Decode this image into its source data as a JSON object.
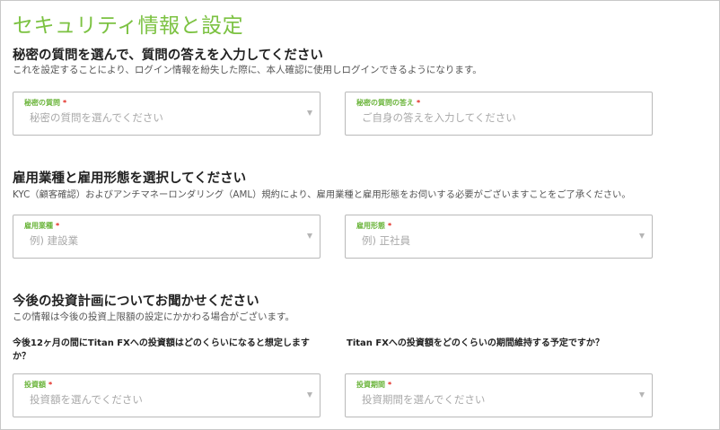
{
  "page": {
    "title": "セキュリティ情報と設定"
  },
  "security": {
    "heading": "秘密の質問を選んで、質問の答えを入力してください",
    "description": "これを設定することにより、ログイン情報を紛失した際に、本人確認に使用しログインできるようになります。",
    "question_field": {
      "label": "秘密の質問",
      "placeholder": "秘密の質問を選んでください"
    },
    "answer_field": {
      "label": "秘密の質問の答え",
      "placeholder": "ご自身の答えを入力してください"
    }
  },
  "employment": {
    "heading": "雇用業種と雇用形態を選択してください",
    "description": "KYC（顧客確認）およびアンチマネーロンダリング（AML）規約により、雇用業種と雇用形態をお伺いする必要がございますことをご了承ください。",
    "industry_field": {
      "label": "雇用業種",
      "placeholder": "例) 建設業"
    },
    "type_field": {
      "label": "雇用形態",
      "placeholder": "例) 正社員"
    }
  },
  "investment": {
    "heading": "今後の投資計画についてお聞かせください",
    "description": "この情報は今後の投資上限額の設定にかかわる場合がございます。",
    "amount_question": "今後12ヶ月の間にTitan FXへの投資額はどのくらいになると想定しますか？",
    "period_question": "Titan FXへの投資額をどのくらいの期間維持する予定ですか？",
    "amount_field": {
      "label": "投資額",
      "placeholder": "投資額を選んでください"
    },
    "period_field": {
      "label": "投資期間",
      "placeholder": "投資期間を選んでください"
    }
  },
  "required_mark": "*",
  "colors": {
    "accent": "#7cc242",
    "label": "#6ab43a",
    "required": "#e2231a",
    "placeholder": "#a9a9a9",
    "border": "#b9b9b9"
  }
}
